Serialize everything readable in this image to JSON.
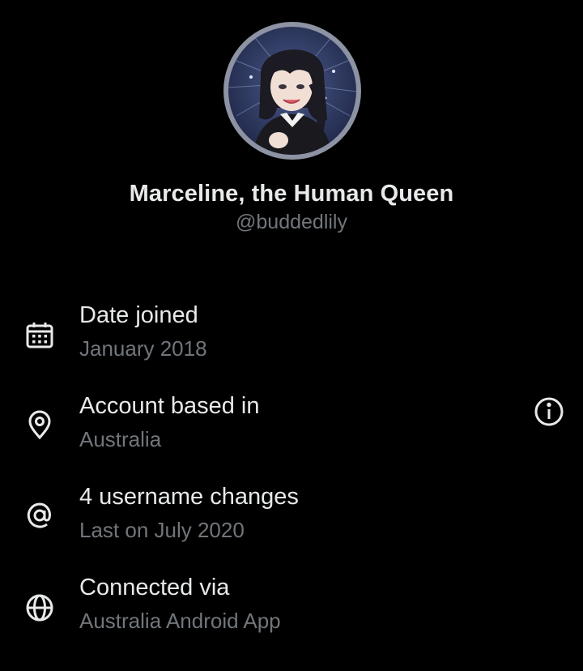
{
  "profile": {
    "display_name": "Marceline, the Human Queen",
    "handle": "@buddedlily",
    "avatar_icon": "avatar-illustration"
  },
  "details": [
    {
      "icon": "calendar-icon",
      "title": "Date joined",
      "subtitle": "January 2018"
    },
    {
      "icon": "location-pin-icon",
      "title": "Account based in",
      "subtitle": "Australia",
      "action_icon": "info-icon"
    },
    {
      "icon": "at-sign-icon",
      "title": "4 username changes",
      "subtitle": "Last on July 2020"
    },
    {
      "icon": "globe-icon",
      "title": "Connected via",
      "subtitle": "Australia Android App"
    }
  ],
  "colors": {
    "background": "#000000",
    "primary_text": "#e7e9ea",
    "secondary_text": "#71767b",
    "avatar_ring": "#8d93a3"
  }
}
